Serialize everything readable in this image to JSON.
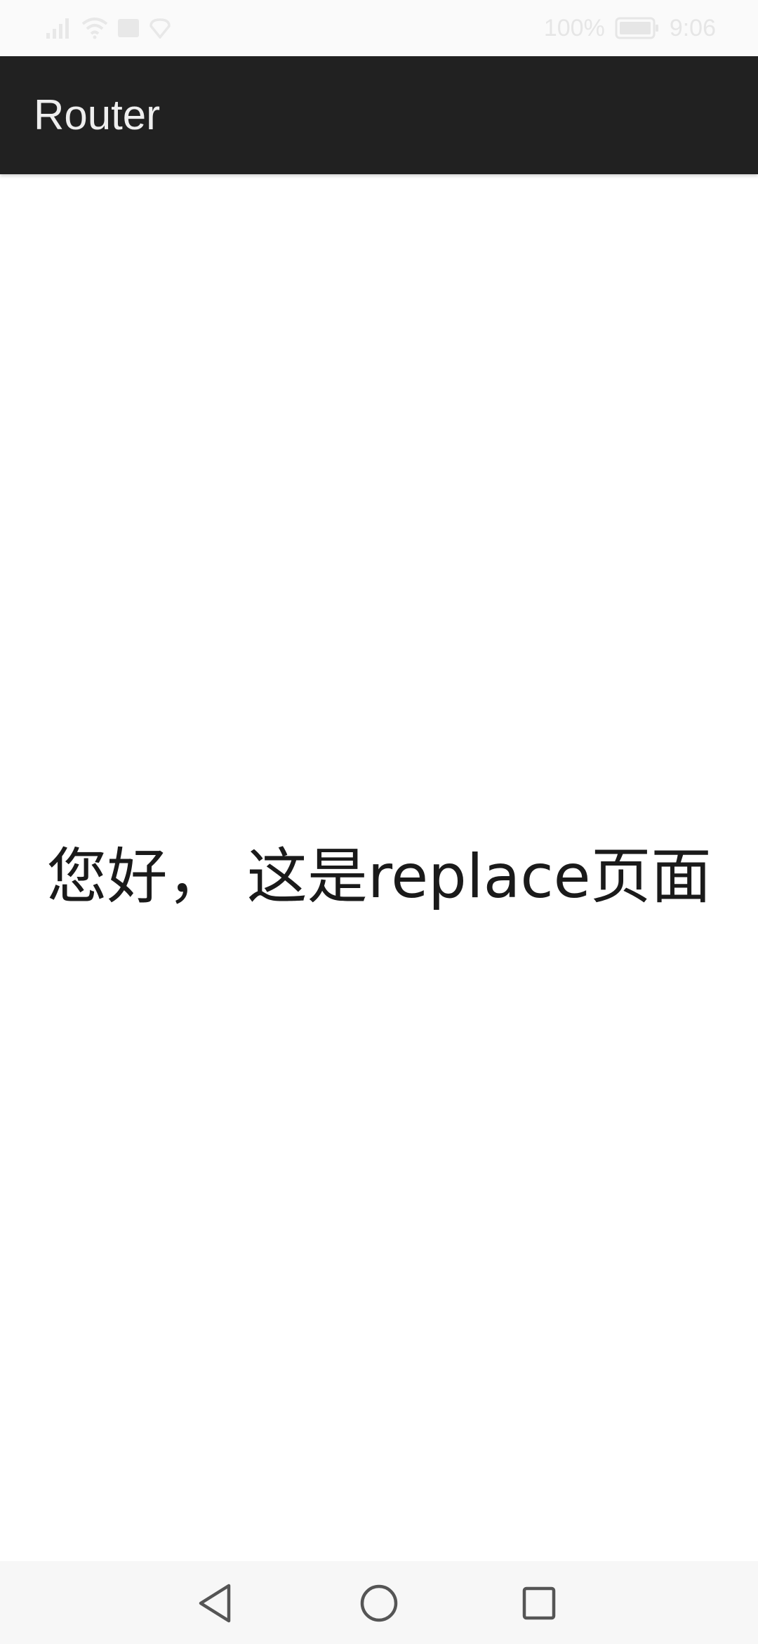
{
  "status_bar": {
    "battery_percent": "100%",
    "time": "9:06",
    "icons": [
      "signal-icon",
      "wifi-icon",
      "sim-card-icon",
      "location-icon",
      "battery-icon"
    ]
  },
  "app_bar": {
    "title": "Router"
  },
  "main": {
    "message": "您好， 这是replace页面"
  },
  "nav_bar": {
    "icons": [
      "back-icon",
      "home-icon",
      "recents-icon"
    ]
  },
  "colors": {
    "app_bar_bg": "#212121",
    "app_bar_text": "#eeeeee",
    "body_bg": "#ffffff",
    "message_text": "#1a1a1a",
    "nav_bar_bg": "#f7f7f7"
  }
}
